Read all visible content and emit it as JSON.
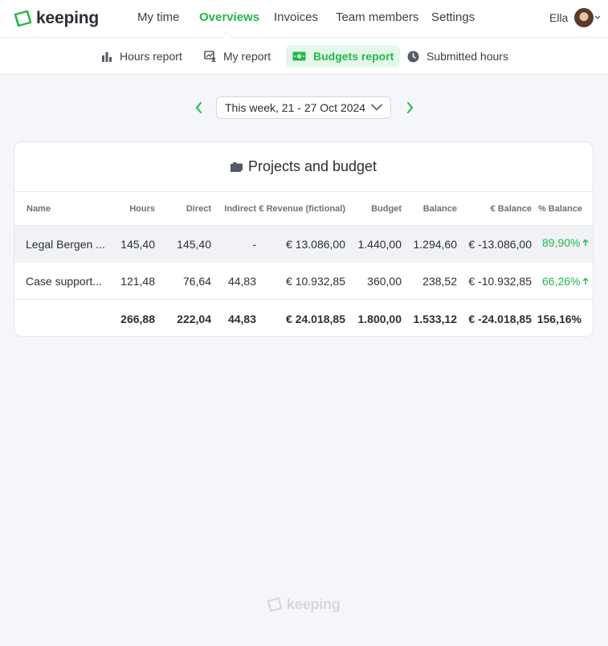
{
  "app": {
    "name": "keeping",
    "brand_color": "#22b84a"
  },
  "nav": {
    "items": [
      {
        "label": "My time"
      },
      {
        "label": "Overviews",
        "active": true
      },
      {
        "label": "Invoices"
      },
      {
        "label": "Team members"
      },
      {
        "label": "Settings"
      }
    ],
    "user": {
      "name": "Ella"
    }
  },
  "subnav": {
    "items": [
      {
        "label": "Hours report",
        "icon": "bar-chart-icon"
      },
      {
        "label": "My report",
        "icon": "user-chart-icon"
      },
      {
        "label": "Budgets report",
        "icon": "money-icon",
        "active": true
      },
      {
        "label": "Submitted hours",
        "icon": "clock-icon"
      }
    ]
  },
  "period": {
    "label": "This week, 21 - 27 Oct 2024"
  },
  "card": {
    "title": "Projects and budget",
    "columns": [
      "Name",
      "Hours",
      "Direct",
      "Indirect",
      "€ Revenue (fictional)",
      "Budget",
      "Balance",
      "€ Balance",
      "% Balance"
    ],
    "rows": [
      {
        "name": "Legal Bergen ...",
        "hours": "145,40",
        "direct": "145,40",
        "indirect": "-",
        "revenue": "€ 13.086,00",
        "budget": "1.440,00",
        "balance": "1.294,60",
        "eur_balance": "€ -13.086,00",
        "pct_balance": "89,90%"
      },
      {
        "name": "Case support...",
        "hours": "121,48",
        "direct": "76,64",
        "indirect": "44,83",
        "revenue": "€ 10.932,85",
        "budget": "360,00",
        "balance": "238,52",
        "eur_balance": "€ -10.932,85",
        "pct_balance": "66,26%"
      }
    ],
    "totals": {
      "hours": "266,88",
      "direct": "222,04",
      "indirect": "44,83",
      "revenue": "€ 24.018,85",
      "budget": "1.800,00",
      "balance": "1.533,12",
      "eur_balance": "€ -24.018,85",
      "pct_balance": "156,16%"
    }
  },
  "footer": {
    "brand": "keeping"
  }
}
